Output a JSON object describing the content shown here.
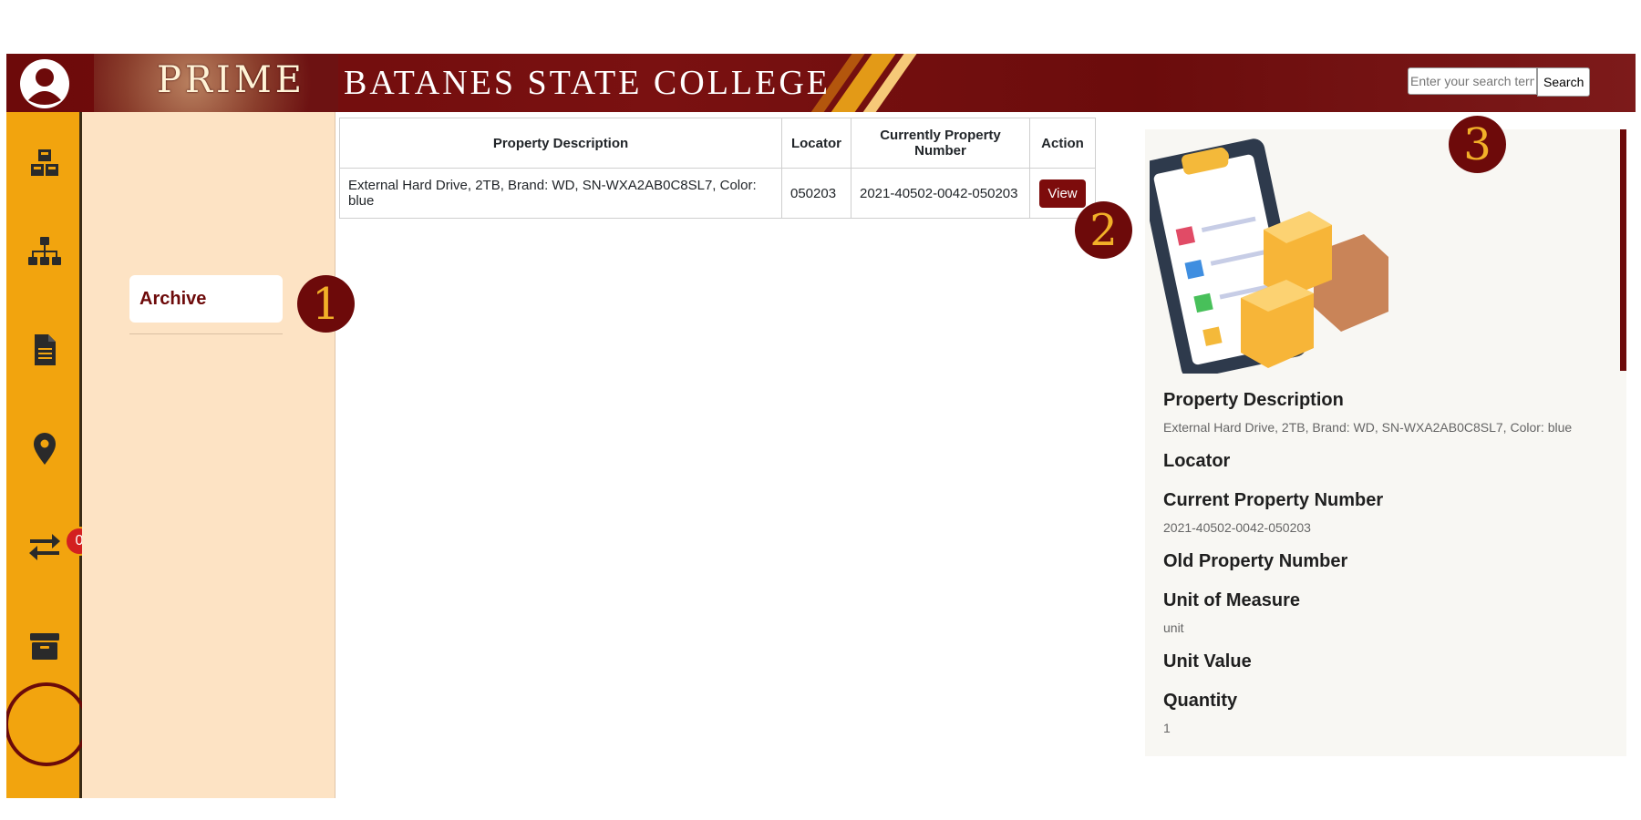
{
  "header": {
    "brand": "PRIME",
    "college_name": "BATANES STATE COLLEGE",
    "search_placeholder": "Enter your search term",
    "search_button": "Search"
  },
  "rail": {
    "items": [
      {
        "name": "inventory",
        "icon": "cubes-icon"
      },
      {
        "name": "organization",
        "icon": "sitemap-icon"
      },
      {
        "name": "documents",
        "icon": "document-icon"
      },
      {
        "name": "locations",
        "icon": "map-pin-icon"
      },
      {
        "name": "transfers",
        "icon": "exchange-arrows-icon",
        "badge": "0"
      },
      {
        "name": "archive",
        "icon": "archive-box-icon",
        "selected": true
      }
    ]
  },
  "sidebar": {
    "archive_label": "Archive"
  },
  "table": {
    "columns": [
      "Property Description",
      "Locator",
      "Currently Property Number",
      "Action"
    ],
    "rows": [
      {
        "description": "External Hard Drive, 2TB, Brand: WD, SN-WXA2AB0C8SL7, Color: blue",
        "locator": "050203",
        "property_number": "2021-40502-0042-050203",
        "action": "View"
      }
    ]
  },
  "markers": [
    "1",
    "2",
    "3"
  ],
  "details": {
    "fields": [
      {
        "label": "Property Description",
        "value": "External Hard Drive, 2TB, Brand: WD, SN-WXA2AB0C8SL7, Color: blue"
      },
      {
        "label": "Locator",
        "value": ""
      },
      {
        "label": "Current Property Number",
        "value": "2021-40502-0042-050203"
      },
      {
        "label": "Old Property Number",
        "value": ""
      },
      {
        "label": "Unit of Measure",
        "value": "unit"
      },
      {
        "label": "Unit Value",
        "value": ""
      },
      {
        "label": "Quantity",
        "value": "1"
      }
    ]
  },
  "colors": {
    "maroon": "#6d0a0a",
    "gold": "#f2a40e",
    "cream": "#fde3c4"
  }
}
